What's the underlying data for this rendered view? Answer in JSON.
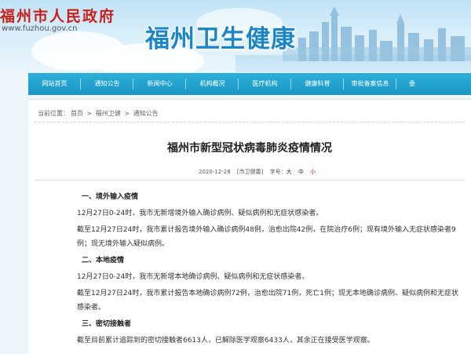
{
  "header": {
    "gov_name": "福州市人民政府",
    "gov_url": "www.fuzhou.gov.cn",
    "site_title": "福州卫生健康"
  },
  "nav": {
    "items": [
      {
        "label": "网站首页"
      },
      {
        "label": "通知公告"
      },
      {
        "label": "新闻中心"
      },
      {
        "label": "机构概况"
      },
      {
        "label": "医疗机构"
      },
      {
        "label": "健康科普"
      },
      {
        "label": "审批备案信息"
      },
      {
        "label": "委"
      }
    ]
  },
  "breadcrumb": {
    "prefix": "当前位置：",
    "items": [
      "首页",
      "福州卫健",
      "通知公告"
    ],
    "separator": " > "
  },
  "article": {
    "title": "福州市新型冠状病毒肺炎疫情情况",
    "date": "2020-12-28",
    "source": "[市卫健委]",
    "font_size_label": "字号：",
    "font_big": "大",
    "font_mid": "中",
    "font_small": "小",
    "sections": [
      {
        "heading": "一、境外输入疫情",
        "paragraphs": [
          "12月27日0-24时，我市无新增境外输入确诊病例、疑似病例和无症状感染者。",
          "截至12月27日24时，我市累计报告境外输入确诊病例48例，治愈出院42例，在院治疗6例；现有境外输入无症状感染者9例；现无境外输入疑似病例。"
        ]
      },
      {
        "heading": "二、本地疫情",
        "paragraphs": [
          "12月27日0-24时，我市无新增本地确诊病例、疑似病例和无症状感染者。",
          "截至12月27日24时，我市累计报告本地确诊病例72例，治愈出院71例，死亡1例；现无本地确诊病例、疑似病例和无症状感染者。"
        ]
      },
      {
        "heading": "三、密切接触者",
        "paragraphs": [
          "截至目前累计追踪到的密切接触者6613人，已解除医学观察6433人，其余正在接受医学观察。"
        ]
      }
    ]
  },
  "colors": {
    "nav_bg": "#1a94c4",
    "title_blue": "#1b86c7",
    "gov_red": "#c8201a"
  }
}
